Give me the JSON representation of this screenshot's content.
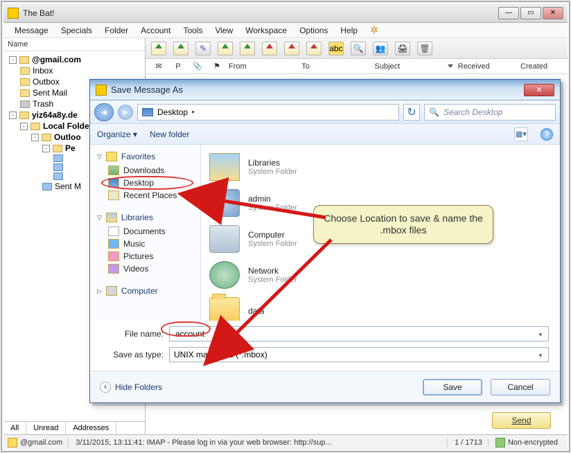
{
  "app": {
    "title": "The Bat!"
  },
  "menu": [
    "Message",
    "Specials",
    "Folder",
    "Account",
    "Tools",
    "View",
    "Workspace",
    "Options",
    "Help"
  ],
  "leftPane": {
    "header": "Name",
    "account": "@gmail.com",
    "items": {
      "inbox": "Inbox",
      "outbox": "Outbox",
      "sent": "Sent Mail",
      "trash": "Trash",
      "acct2": "yiz64a8y.de",
      "local": "Local Folders",
      "outlook": "Outloo",
      "pe": "Pe",
      "sentm": "Sent M"
    },
    "tabs": [
      "All",
      "Unread",
      "Addresses"
    ]
  },
  "msgHeader": {
    "from": "From",
    "to": "To",
    "subject": "Subject",
    "received": "Received",
    "created": "Created"
  },
  "sendBtn": "Send",
  "statusbar": {
    "acct": "@gmail.com",
    "msg": "3/11/2015, 13:11:41: IMAP  -  Please log in via your web browser: http://sup...",
    "count": "1 / 1713",
    "sec": "Non-encrypted"
  },
  "dialog": {
    "title": "Save Message As",
    "path": {
      "root": "Desktop",
      "sep": "▸"
    },
    "searchPlaceholder": "Search Desktop",
    "toolbar": {
      "organize": "Organize ▾",
      "newfolder": "New folder"
    },
    "sidebar": {
      "fav": "Favorites",
      "downloads": "Downloads",
      "desktop": "Desktop",
      "recent": "Recent Places",
      "lib": "Libraries",
      "docs": "Documents",
      "music": "Music",
      "pics": "Pictures",
      "vids": "Videos",
      "comp": "Computer"
    },
    "content": [
      {
        "t1": "Libraries",
        "t2": "System Folder",
        "kind": "lib"
      },
      {
        "t1": "admin",
        "t2": "System Folder",
        "kind": "user"
      },
      {
        "t1": "Computer",
        "t2": "System Folder",
        "kind": "comp"
      },
      {
        "t1": "Network",
        "t2": "System Folder",
        "kind": "net"
      },
      {
        "t1": "data",
        "t2": "",
        "kind": "folder"
      }
    ],
    "fields": {
      "filenameLabel": "File name:",
      "filenameValue": "account",
      "typeLabel": "Save as type:",
      "typeValue": "UNIX mailboxes (*.mbox)"
    },
    "footer": {
      "hide": "Hide Folders",
      "save": "Save",
      "cancel": "Cancel"
    }
  },
  "callout": "Choose Location to save & name the .mbox files"
}
